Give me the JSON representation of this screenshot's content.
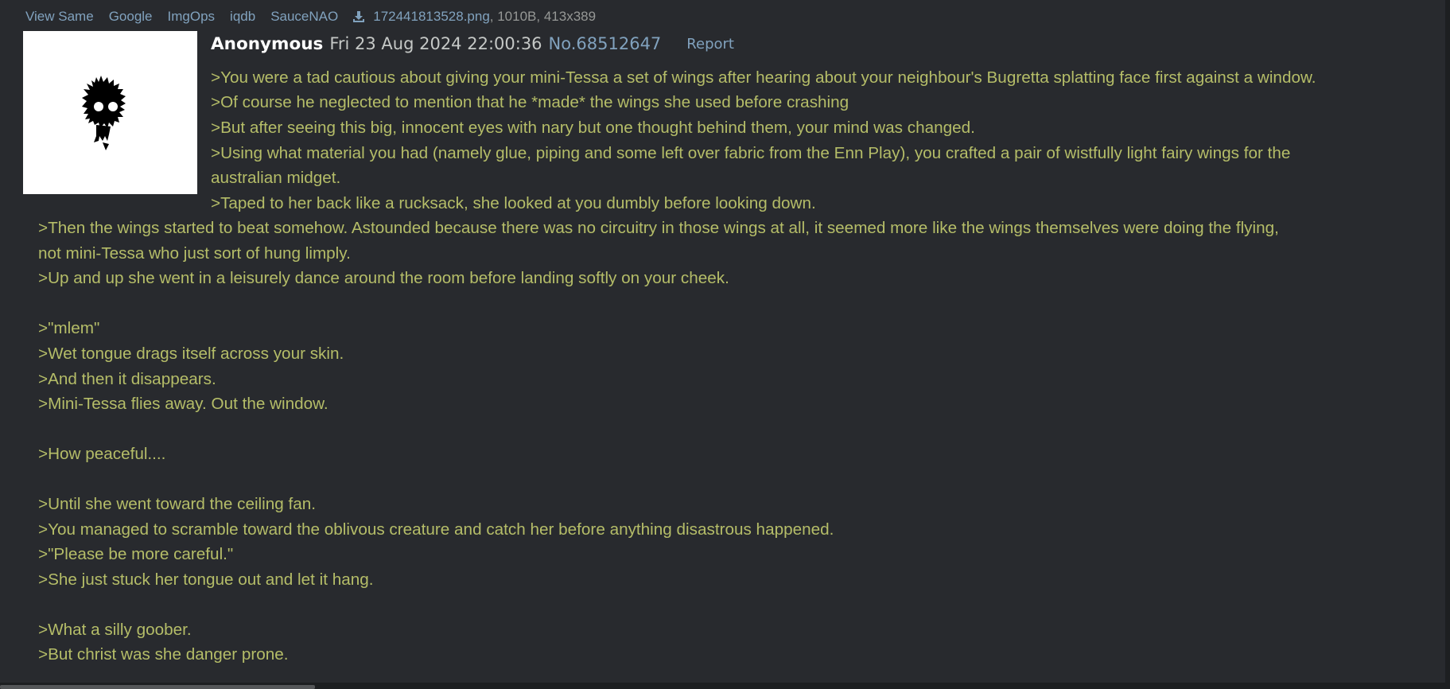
{
  "file_links": {
    "view_same": "View Same",
    "google": "Google",
    "imgops": "ImgOps",
    "iqdb": "iqdb",
    "saucenao": "SauceNAO",
    "download_icon": "download-icon",
    "filename": "172441813528.png",
    "meta": ", 1010B, 413x389"
  },
  "post": {
    "name": "Anonymous",
    "datetime": "Fri 23 Aug 2024 22:00:36",
    "number": "No.68512647",
    "report": "Report",
    "lines": [
      ">You were a tad cautious about giving your mini-Tessa a set of wings after hearing about your neighbour's Bugretta splatting face first against a window.",
      ">Of course he neglected to mention that he *made* the wings she used before crashing",
      ">But after seeing this big, innocent eyes with nary but one thought behind them, your mind was changed.",
      ">Using what material you had (namely glue, piping and some left over fabric from the Enn Play), you crafted a pair of wistfully light fairy wings for the",
      "australian midget.",
      ">Taped to her back like a rucksack, she looked at you dumbly before looking down.",
      ">Then the wings started to beat somehow. Astounded because there was no circuitry in those wings at all, it seemed more like the wings themselves were doing the flying,",
      "not mini-Tessa who just sort of hung limply.",
      ">Up and up she went in a leisurely dance around the room before landing softly on your cheek.",
      ">\"mlem\"",
      ">Wet tongue drags itself across your skin.",
      ">And then it disappears.",
      ">Mini-Tessa flies away. Out the window.",
      ">How peaceful....",
      ">Until she went toward the ceiling fan.",
      ">You managed to scramble toward the oblivous creature and catch her before anything disastrous happened.",
      ">\"Please be more careful.\"",
      ">She just stuck her tongue out and let it hang.",
      ">What a silly goober.",
      ">But christ was she danger prone."
    ]
  },
  "colors": {
    "background": "#282a2e",
    "greentext": "#b5bd68",
    "link": "#81a2be",
    "name": "#ffffff",
    "meta": "#969896"
  },
  "scrollbar": {
    "position_fraction": 0.0,
    "visible_fraction": 0.22
  }
}
